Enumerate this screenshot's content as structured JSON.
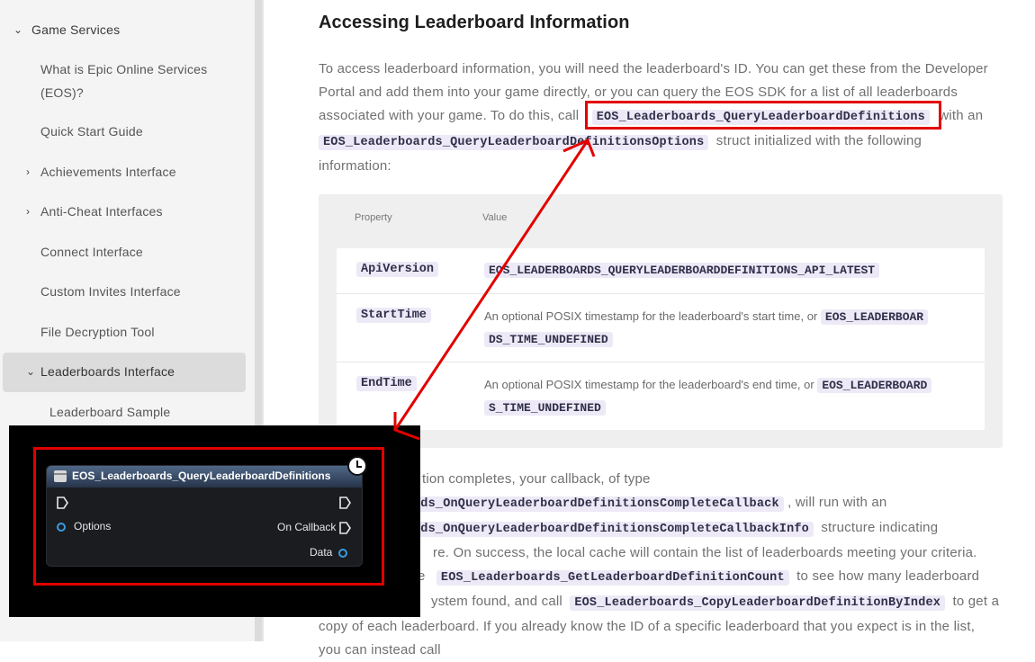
{
  "sidebar": {
    "section": {
      "label": "Game Services"
    },
    "items": [
      {
        "label": "What is Epic Online Services",
        "label2": "(EOS)?"
      },
      {
        "label": "Quick Start Guide"
      },
      {
        "label": "Achievements Interface"
      },
      {
        "label": "Anti-Cheat Interfaces"
      },
      {
        "label": "Connect Interface"
      },
      {
        "label": "Custom Invites Interface"
      },
      {
        "label": "File Decryption Tool"
      },
      {
        "label": "Leaderboards Interface"
      },
      {
        "label": "Leaderboard Sample"
      }
    ]
  },
  "main": {
    "heading": "Accessing Leaderboard Information",
    "intro": {
      "line1": "To access leaderboard information, you will need the leaderboard's ID. You can get these from the Developer",
      "line2": "Portal and add them into your game directly, or you can query the EOS SDK for a list of all leaderboards",
      "line3a": "associated with your game. To do this, call",
      "code1": "EOS_Leaderboards_QueryLeaderboardDefinitions",
      "line3b": "with an",
      "code2": "EOS_Leaderboards_QueryLeaderboardDefinitionsOptions",
      "line4b": "struct initialized with the following",
      "line5": "information:"
    },
    "table": {
      "col_property": "Property",
      "col_value": "Value",
      "rows": [
        {
          "prop": "ApiVersion",
          "code": "EOS_LEADERBOARDS_QUERYLEADERBOARDDEFINITIONS_API_LATEST"
        },
        {
          "prop": "StartTime",
          "text": "An optional POSIX timestamp for the leaderboard's start time, or",
          "code_a": "EOS_LEADERBOAR",
          "code_b": "DS_TIME_UNDEFINED"
        },
        {
          "prop": "EndTime",
          "text": "An optional POSIX timestamp for the leaderboard's end time, or",
          "code_a": "EOS_LEADERBOARD",
          "code_b": "S_TIME_UNDEFINED"
        }
      ]
    },
    "after": {
      "l1": "tion completes, your callback, of type",
      "l2code": "rds_OnQueryLeaderboardDefinitionsCompleteCallback",
      "l2text": ", will run with an",
      "l3code": "rds_OnQueryLeaderboardDefinitionsCompleteCallbackInfo",
      "l3text": "structure indicating",
      "l4": "re. On success, the local cache will contain the list of leaderboards meeting your criteria.",
      "l5a": "e",
      "l5code": "EOS_Leaderboards_GetLeaderboardDefinitionCount",
      "l5b": "to see how many leaderboard",
      "l6a": "ystem found, and call",
      "l6code": "EOS_Leaderboards_CopyLeaderboardDefinitionByIndex",
      "l6b": "to get a",
      "l7": "copy of each leaderboard. If you already know the ID of a specific leaderboard that you expect is in the list,",
      "l8": "you can instead call"
    }
  },
  "blueprint": {
    "node_title": "EOS_Leaderboards_QueryLeaderboardDefinitions",
    "pin_options": "Options",
    "pin_on_callback": "On Callback",
    "pin_data": "Data"
  },
  "colors": {
    "highlight_red": "#e20000",
    "code_bg": "#ede9f6",
    "pin_blue": "#3a9be0"
  }
}
